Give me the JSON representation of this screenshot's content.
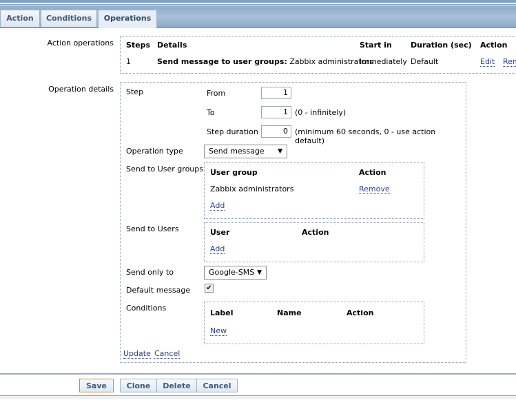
{
  "tabs": [
    {
      "label": "Action"
    },
    {
      "label": "Conditions"
    },
    {
      "label": "Operations",
      "active": true
    }
  ],
  "action_operations": {
    "label": "Action operations",
    "headers": [
      "Steps",
      "Details",
      "Start in",
      "Duration (sec)",
      "Action"
    ],
    "rows": [
      {
        "step": "1",
        "details_bold": "Send message to user groups:",
        "details": "Zabbix administrators",
        "start_in": "Immediately",
        "duration": "Default",
        "edit": "Edit",
        "remove": "Remove"
      }
    ]
  },
  "operation_details": {
    "label": "Operation details",
    "step_label": "Step",
    "from_label": "From",
    "from_value": "1",
    "to_label": "To",
    "to_value": "1",
    "to_hint": "(0 - infinitely)",
    "duration_label": "Step duration",
    "duration_value": "0",
    "duration_hint": "(minimum 60 seconds, 0 - use action default)",
    "op_type_label": "Operation type",
    "op_type_value": "Send message",
    "user_groups_label": "Send to User groups",
    "user_groups": {
      "headers": [
        "User group",
        "Action"
      ],
      "rows": [
        {
          "name": "Zabbix administrators",
          "action": "Remove"
        }
      ],
      "add": "Add"
    },
    "users_label": "Send to Users",
    "users": {
      "headers": [
        "User",
        "Action"
      ],
      "add": "Add"
    },
    "send_only_label": "Send only to",
    "send_only_value": "Google-SMS",
    "default_msg_label": "Default message",
    "default_msg_checked": true,
    "conditions_label": "Conditions",
    "conditions": {
      "headers": [
        "Label",
        "Name",
        "Action"
      ],
      "new": "New"
    },
    "update": "Update",
    "cancel": "Cancel"
  },
  "buttons": {
    "save": "Save",
    "clone": "Clone",
    "delete": "Delete",
    "cancel": "Cancel"
  }
}
